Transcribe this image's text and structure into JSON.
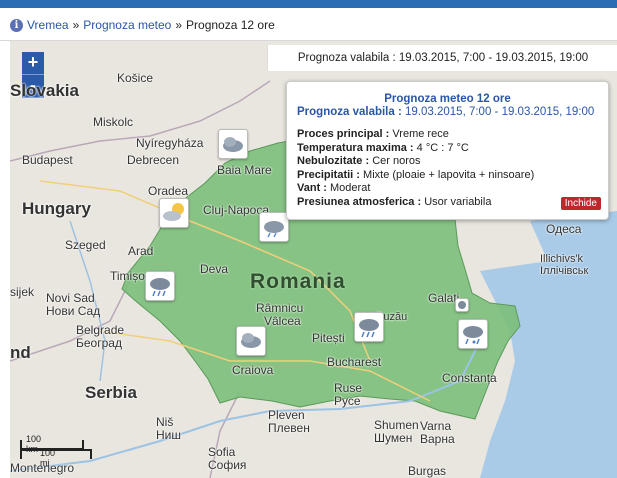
{
  "breadcrumb": {
    "info_icon": "i",
    "items": [
      "Vremea",
      "Prognoza meteo",
      "Prognoza 12 ore"
    ],
    "separator": "»"
  },
  "map": {
    "zoom_in": "+",
    "zoom_out": "-",
    "validity_bar": "Prognoza valabila : 19.03.2015, 7:00 - 19.03.2015, 19:00",
    "labels": {
      "slovakia": "Slovakia",
      "kosice": "Košice",
      "miskolc": "Miskolc",
      "nyiregyhaza": "Nyíregyháza",
      "budapest": "Budapest",
      "debrecen": "Debrecen",
      "hungary": "Hungary",
      "oradea": "Oradea",
      "baia_mare": "Baia Mare",
      "cluj": "Cluj-Napoca",
      "szeged": "Szeged",
      "arad": "Arad",
      "timisoara": "Timișoara",
      "deva": "Deva",
      "romania": "Romania",
      "sijek": "sijek",
      "novi_sad_lat": "Novi Sad",
      "novi_sad_cyr": "Нови Сад",
      "belgrade_lat": "Belgrade",
      "belgrade_cyr": "Београд",
      "ramnicu1": "Râmnicu",
      "ramnicu2": "Vâlcea",
      "pitesti": "Pitești",
      "craiova": "Craiova",
      "bucharest": "Bucharest",
      "ruse_lat": "Ruse",
      "ruse_cyr": "Русе",
      "galati": "Galati",
      "constanta": "Constanța",
      "odesa": "Одеса",
      "illichivsk_lat": "Illichivs'k",
      "illichivsk_cyr": "Іллічівськ",
      "serbia": "Serbia",
      "nis_lat": "Niš",
      "nis_cyr": "Ниш",
      "pleven_lat": "Pleven",
      "pleven_cyr": "Плевен",
      "shumen_lat": "Shumen",
      "shumen_cyr": "Шумен",
      "varna_lat": "Varna",
      "varna_cyr": "Варна",
      "sofia_lat": "Sofia",
      "sofia_cyr": "София",
      "burgas": "Burgas",
      "buzau": "Buzău",
      "land_fragment": "nd",
      "montenegro": "Montenegro",
      "scale_km": "100 km",
      "scale_mi": "100 mi"
    },
    "weather_icons": [
      "cloudy-icon",
      "partly-sunny-icon",
      "cloudy-icon",
      "rain-icon",
      "rain-icon",
      "cloudy-icon",
      "rain-snow-icon",
      "rain-snow-icon"
    ]
  },
  "popup": {
    "title": "Prognoza meteo 12 ore",
    "valid_label": "Prognoza valabila :",
    "valid_value": "19.03.2015, 7:00 - 19.03.2015, 19:00",
    "rows": [
      {
        "label": "Proces principal :",
        "value": "Vreme rece"
      },
      {
        "label": "Temperatura maxima :",
        "value": "4 °C : 7 °C"
      },
      {
        "label": "Nebulozitate :",
        "value": "Cer noros"
      },
      {
        "label": "Precipitatii :",
        "value": "Mixte (ploaie + lapovita + ninsoare)"
      },
      {
        "label": "Vant :",
        "value": "Moderat"
      },
      {
        "label": "Presiunea atmosferica :",
        "value": "Usor variabila"
      }
    ],
    "close_label": "Inchide"
  },
  "colors": {
    "romania_fill": "#7bbf7a",
    "sea": "#a9cbe8",
    "land": "#e9e6df",
    "accent": "#2a56a6",
    "close_button": "#c0272d"
  }
}
